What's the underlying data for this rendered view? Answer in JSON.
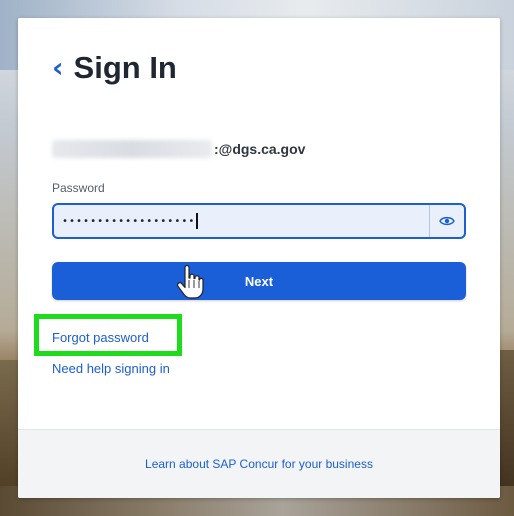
{
  "header": {
    "back_symbol": "‹",
    "title": "Sign In"
  },
  "account": {
    "email_suffix": ":@dgs.ca.gov"
  },
  "password": {
    "label": "Password",
    "masked_value": "•••••••••••••••••••",
    "toggle_icon": "eye-icon"
  },
  "actions": {
    "next_label": "Next",
    "forgot_password": "Forgot password",
    "need_help": "Need help signing in"
  },
  "footer": {
    "link": "Learn about SAP Concur for your business"
  },
  "colors": {
    "accent": "#1b5fd1",
    "button": "#1a5ed8",
    "highlight": "#1cdc1c"
  }
}
